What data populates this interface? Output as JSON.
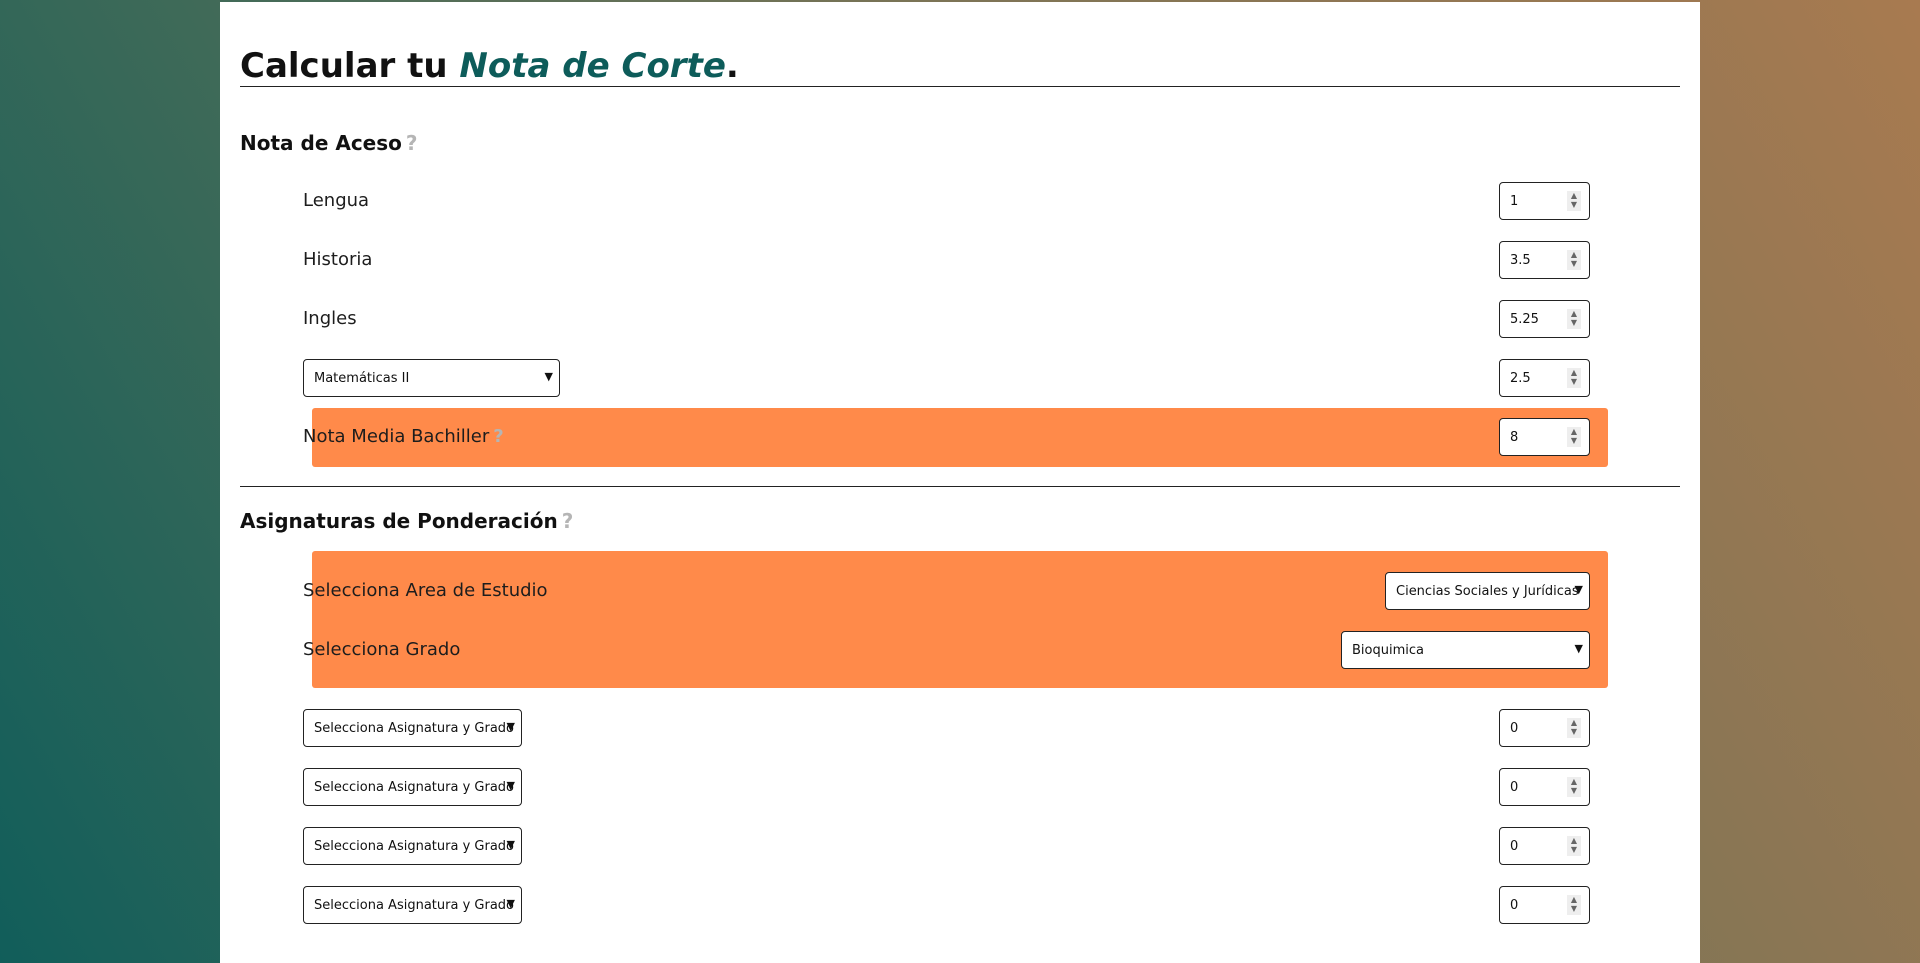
{
  "title": {
    "prefix": "Calcular tu ",
    "highlight": "Nota de Corte",
    "suffix": "."
  },
  "acceso": {
    "heading": "Nota de Aceso",
    "help": "?",
    "subjects": [
      {
        "label": "Lengua",
        "value": "1"
      },
      {
        "label": "Historia",
        "value": "3.5"
      },
      {
        "label": "Ingles",
        "value": "5.25"
      }
    ],
    "optional": {
      "selected": "Matemáticas II",
      "value": "2.5"
    },
    "media": {
      "label": "Nota Media Bachiller",
      "help": "?",
      "value": "8"
    }
  },
  "ponderacion": {
    "heading": "Asignaturas de Ponderación",
    "help": "?",
    "area": {
      "label": "Selecciona Area de Estudio",
      "selected": "Ciencias Sociales y Jurídicas"
    },
    "grado": {
      "label": "Selecciona Grado",
      "selected": "Bioquimica"
    },
    "rows": [
      {
        "selected": "Selecciona Asignatura y Grado",
        "value": "0"
      },
      {
        "selected": "Selecciona Asignatura y Grado",
        "value": "0"
      },
      {
        "selected": "Selecciona Asignatura y Grado",
        "value": "0"
      },
      {
        "selected": "Selecciona Asignatura y Grado",
        "value": "0"
      }
    ]
  },
  "colors": {
    "accent": "#ff8a4a",
    "brand": "#0d5c5a"
  }
}
